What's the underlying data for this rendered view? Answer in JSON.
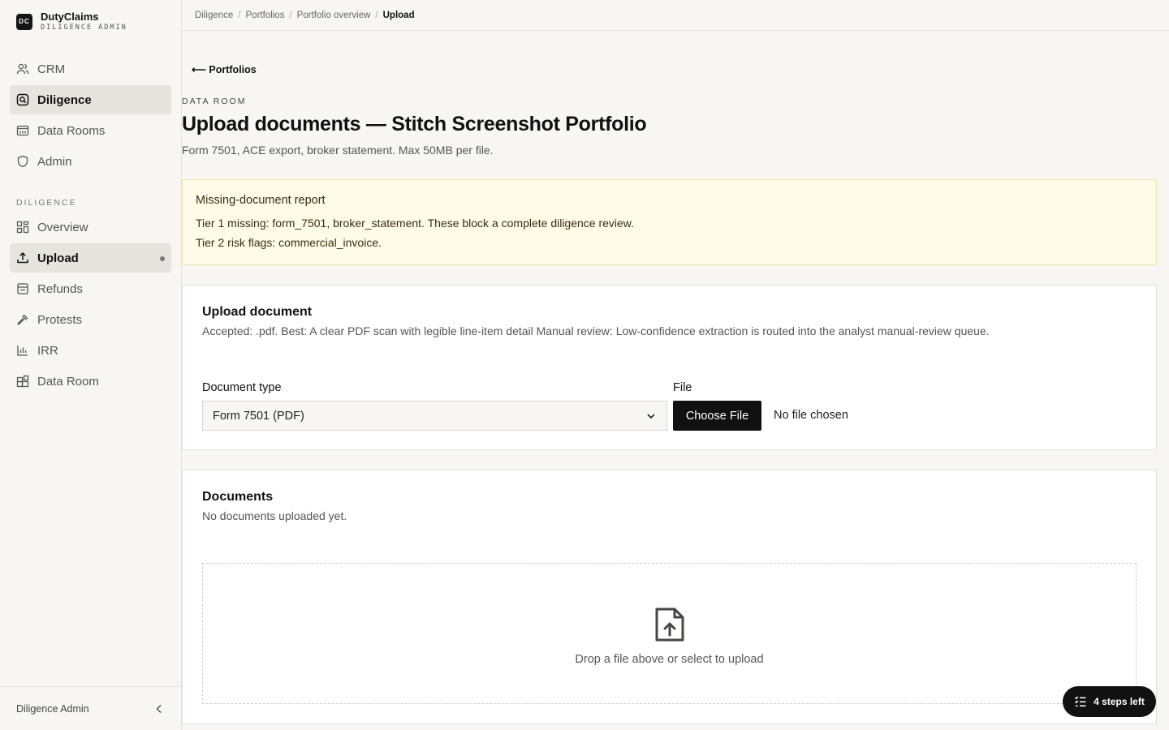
{
  "brand": {
    "logo": "DC",
    "name": "DutyClaims",
    "subtitle": "DILIGENCE ADMIN"
  },
  "nav_top": [
    {
      "label": "CRM",
      "icon": "users-icon"
    },
    {
      "label": "Diligence",
      "icon": "search-icon",
      "active": true
    },
    {
      "label": "Data Rooms",
      "icon": "folder-icon"
    },
    {
      "label": "Admin",
      "icon": "shield-icon"
    }
  ],
  "nav_section_label": "DILIGENCE",
  "nav_section": [
    {
      "label": "Overview",
      "icon": "grid-icon"
    },
    {
      "label": "Upload",
      "icon": "upload-icon",
      "active": true
    },
    {
      "label": "Refunds",
      "icon": "receipt-icon"
    },
    {
      "label": "Protests",
      "icon": "gavel-icon"
    },
    {
      "label": "IRR",
      "icon": "bar-chart-icon"
    },
    {
      "label": "Data Room",
      "icon": "blocks-icon"
    }
  ],
  "sidebar_footer": {
    "label": "Diligence Admin"
  },
  "breadcrumb": [
    "Diligence",
    "Portfolios",
    "Portfolio overview",
    "Upload"
  ],
  "back_link": "⟵ Portfolios",
  "eyebrow": "DATA ROOM",
  "page_title": "Upload documents — Stitch Screenshot Portfolio",
  "page_subtitle": "Form 7501, ACE export, broker statement. Max 50MB per file.",
  "alert": {
    "title": "Missing-document report",
    "line1": "Tier 1 missing: form_7501, broker_statement. These block a complete diligence review.",
    "line2": "Tier 2 risk flags: commercial_invoice."
  },
  "upload_card": {
    "title": "Upload document",
    "description": "Accepted: .pdf. Best: A clear PDF scan with legible line-item detail Manual review: Low-confidence extraction is routed into the analyst manual-review queue.",
    "doc_type_label": "Document type",
    "doc_type_value": "Form 7501 (PDF)",
    "file_label": "File",
    "choose_file": "Choose File",
    "file_status": "No file chosen"
  },
  "documents_card": {
    "title": "Documents",
    "empty_text": "No documents uploaded yet.",
    "drop_text": "Drop a file above or select to upload"
  },
  "steps_button": "4 steps left"
}
